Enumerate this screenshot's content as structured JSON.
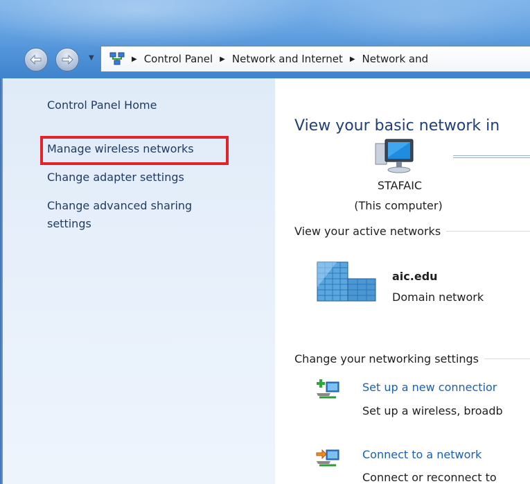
{
  "address_bar": {
    "breadcrumbs": [
      {
        "label": "Control Panel"
      },
      {
        "label": "Network and Internet"
      },
      {
        "label": "Network and"
      }
    ]
  },
  "sidebar": {
    "home_label": "Control Panel Home",
    "items": [
      {
        "label": "Manage wireless networks",
        "highlighted": true
      },
      {
        "label": "Change adapter settings"
      },
      {
        "label": "Change advanced sharing settings"
      }
    ],
    "highlight_color": "#e0242b"
  },
  "main": {
    "title": "View your basic network in",
    "computer": {
      "name": "STAFAIC",
      "subtitle": "(This computer)"
    },
    "active_networks_header": "View your active networks",
    "network": {
      "name": "aic.edu",
      "type": "Domain network"
    },
    "change_settings_header": "Change your networking settings",
    "tasks": [
      {
        "link": "Set up a new connectior",
        "description": "Set up a wireless, broadb"
      },
      {
        "link": "Connect to a network",
        "description": "Connect or reconnect to"
      }
    ]
  },
  "icons": {
    "back": "arrow-left-icon",
    "forward": "arrow-right-icon",
    "location": "network-icon",
    "computer": "computer-icon",
    "network": "building-network-icon",
    "new_connection": "new-connection-icon",
    "connect": "connect-network-icon"
  },
  "colors": {
    "link": "#1a5fb4",
    "title": "#1e3f7a",
    "sidebar_bg": "#e0ebf8",
    "highlight": "#e0242b"
  }
}
